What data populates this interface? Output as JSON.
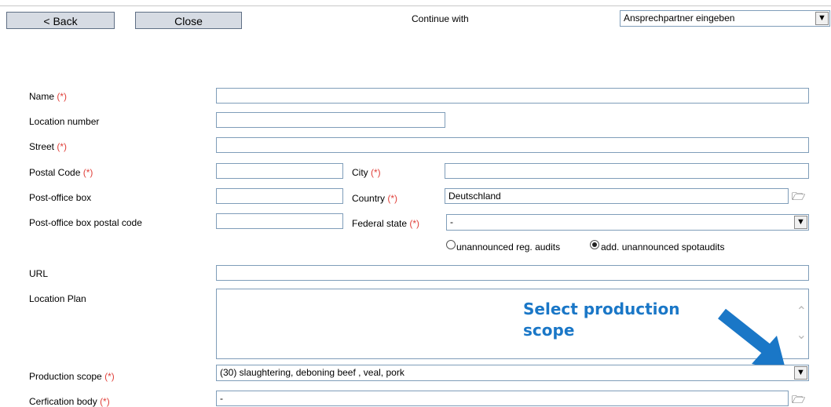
{
  "toolbar": {
    "back_label": "< Back",
    "close_label": "Close",
    "continue_label": "Continue with",
    "continue_value": "Ansprechpartner eingeben"
  },
  "form": {
    "required_marker": "(*)",
    "name_label": "Name",
    "location_number_label": "Location number",
    "street_label": "Street",
    "postal_code_label": "Postal Code",
    "city_label": "City",
    "po_box_label": "Post-office box",
    "country_label": "Country",
    "country_value": "Deutschland",
    "po_box_postal_label": "Post-office box postal code",
    "federal_state_label": "Federal state",
    "federal_state_value": "-",
    "radio_unannounced": "unannounced reg. audits",
    "radio_add_unannounced": "add. unannounced spotaudits",
    "radio_selected": "add_unannounced",
    "url_label": "URL",
    "location_plan_label": "Location Plan",
    "production_scope_label": "Production scope",
    "production_scope_value": "(30) slaughtering, deboning beef , veal, pork",
    "certification_body_label": "Cerfication body",
    "certification_body_value": "-"
  },
  "annotation": {
    "callout_text": "Select production scope",
    "color": "#1a77c7"
  }
}
